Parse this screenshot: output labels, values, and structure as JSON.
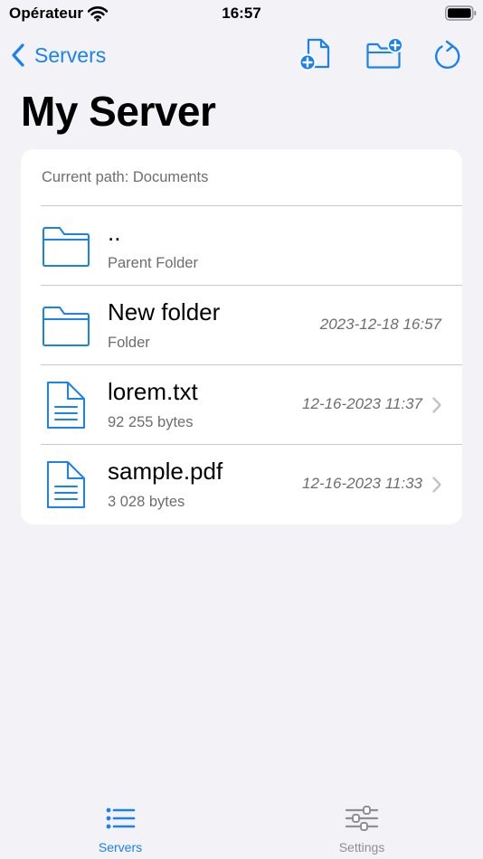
{
  "status_bar": {
    "carrier": "Opérateur",
    "time": "16:57",
    "icons": [
      "wifi-icon",
      "battery-icon"
    ]
  },
  "nav": {
    "back_label": "Servers",
    "icons": [
      "new-file-icon",
      "new-folder-icon",
      "refresh-icon"
    ]
  },
  "title": "My Server",
  "file_list": {
    "current_path": "Current path: Documents",
    "rows": [
      {
        "name": "..",
        "subtitle": "Parent Folder",
        "date": "",
        "icon": "folder-icon",
        "chevron": false
      },
      {
        "name": "New folder",
        "subtitle": "Folder",
        "date": "2023-12-18 16:57",
        "icon": "folder-icon",
        "chevron": false
      },
      {
        "name": "lorem.txt",
        "subtitle": "92 255 bytes",
        "date": "12-16-2023 11:37",
        "icon": "document-icon",
        "chevron": true
      },
      {
        "name": "sample.pdf",
        "subtitle": "3 028 bytes",
        "date": "12-16-2023 11:33",
        "icon": "document-icon",
        "chevron": true
      }
    ]
  },
  "tab_bar": {
    "tabs": [
      {
        "label": "Servers",
        "icon": "list-icon",
        "selected": true
      },
      {
        "label": "Settings",
        "icon": "sliders-icon",
        "selected": false
      }
    ]
  },
  "colors": {
    "accent": "#1a82f0",
    "background": "#f2f2f7",
    "secondary_text": "#6d6d72",
    "inactive_tab": "#8e8e93"
  }
}
